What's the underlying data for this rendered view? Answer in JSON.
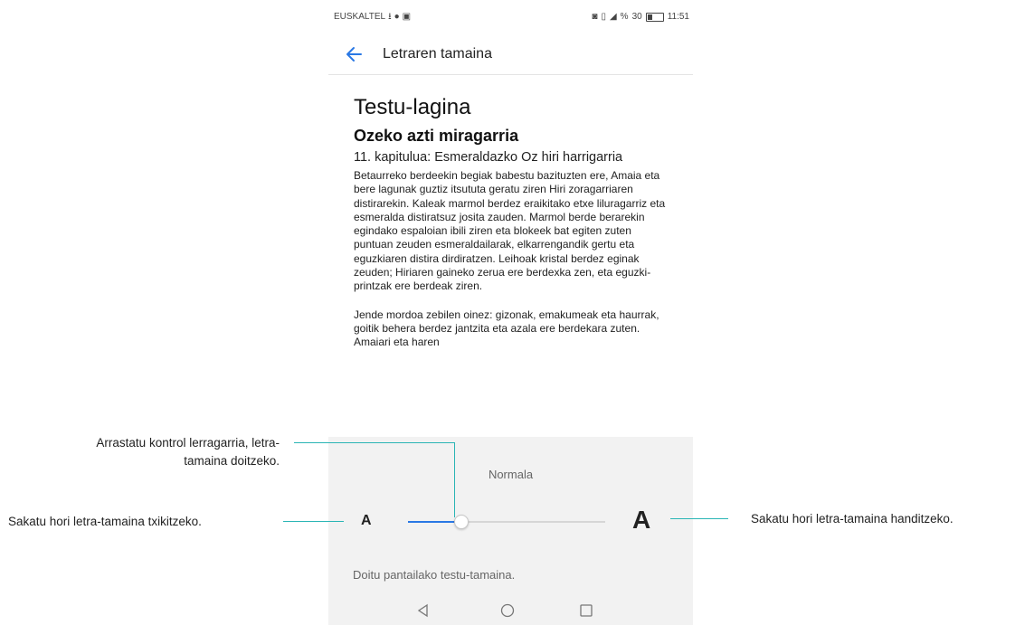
{
  "status_bar": {
    "carrier": "EUSKALTEL",
    "battery_percent": "30",
    "percent_sign": "%",
    "time": "11:51"
  },
  "app_bar": {
    "title": "Letraren tamaina",
    "back_icon": "arrow-left-icon",
    "accent_color": "#2a78e4"
  },
  "preview": {
    "heading": "Testu-lagina",
    "book_title": "Ozeko azti miragarria",
    "chapter": "11. kapitulua: Esmeraldazko Oz hiri harrigarria",
    "paragraphs": [
      "Betaurreko berdeekin begiak babestu bazituzten ere, Amaia eta bere lagunak guztiz itsututa geratu ziren Hiri zoragarriaren distirarekin. Kaleak marmol berdez eraikitako etxe liluragarriz eta esmeralda distiratsuz josita zauden. Marmol berde berarekin egindako espaloian ibili ziren eta blokeek bat egiten zuten puntuan zeuden esmeraldailarak, elkarrengandik gertu eta eguzkiaren distira dirdiratzen. Leihoak kristal berdez eginak zeuden; Hiriaren gaineko zerua ere berdexka zen, eta eguzki-printzak ere berdeak ziren.",
      "Jende mordoa zebilen oinez: gizonak, emakumeak eta haurrak, goitik behera berdez jantzita eta azala ere berdekara zuten. Amaiari eta haren"
    ]
  },
  "font_size_control": {
    "current_size_label": "Normala",
    "small_a_label": "A",
    "large_a_label": "A",
    "slider_value_fraction": 0.27,
    "hint": "Doitu pantailako testu-tamaina."
  },
  "nav_bar": {
    "back_icon": "triangle-back-icon",
    "home_icon": "circle-home-icon",
    "recents_icon": "square-recents-icon"
  },
  "callouts": {
    "slider": "Arrastatu kontrol lerragarria, letra-tamaina doitzeko.",
    "slider_line1": "Arrastatu kontrol lerragarria, letra-",
    "slider_line2": "tamaina doitzeko.",
    "decrease": "Sakatu hori letra-tamaina txikitzeko.",
    "increase": "Sakatu hori letra-tamaina handitzeko.",
    "line_color": "#2ab5b5"
  }
}
